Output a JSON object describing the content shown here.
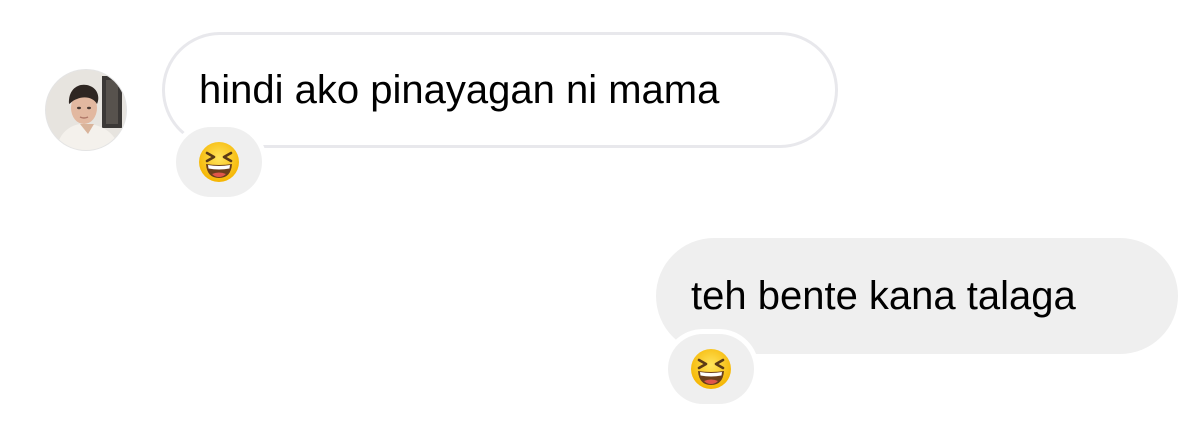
{
  "conversation": {
    "messages": [
      {
        "direction": "incoming",
        "text": "hindi ako pinayagan ni mama",
        "reaction": "😆",
        "reaction_icon": "grinning-squinting-face-icon"
      },
      {
        "direction": "outgoing",
        "text": "teh bente kana talaga",
        "reaction": "😆",
        "reaction_icon": "grinning-squinting-face-icon"
      }
    ]
  },
  "colors": {
    "incoming_bubble_border": "#e8e8ec",
    "outgoing_bubble_bg": "#efefef",
    "reaction_bg": "#efefef"
  }
}
